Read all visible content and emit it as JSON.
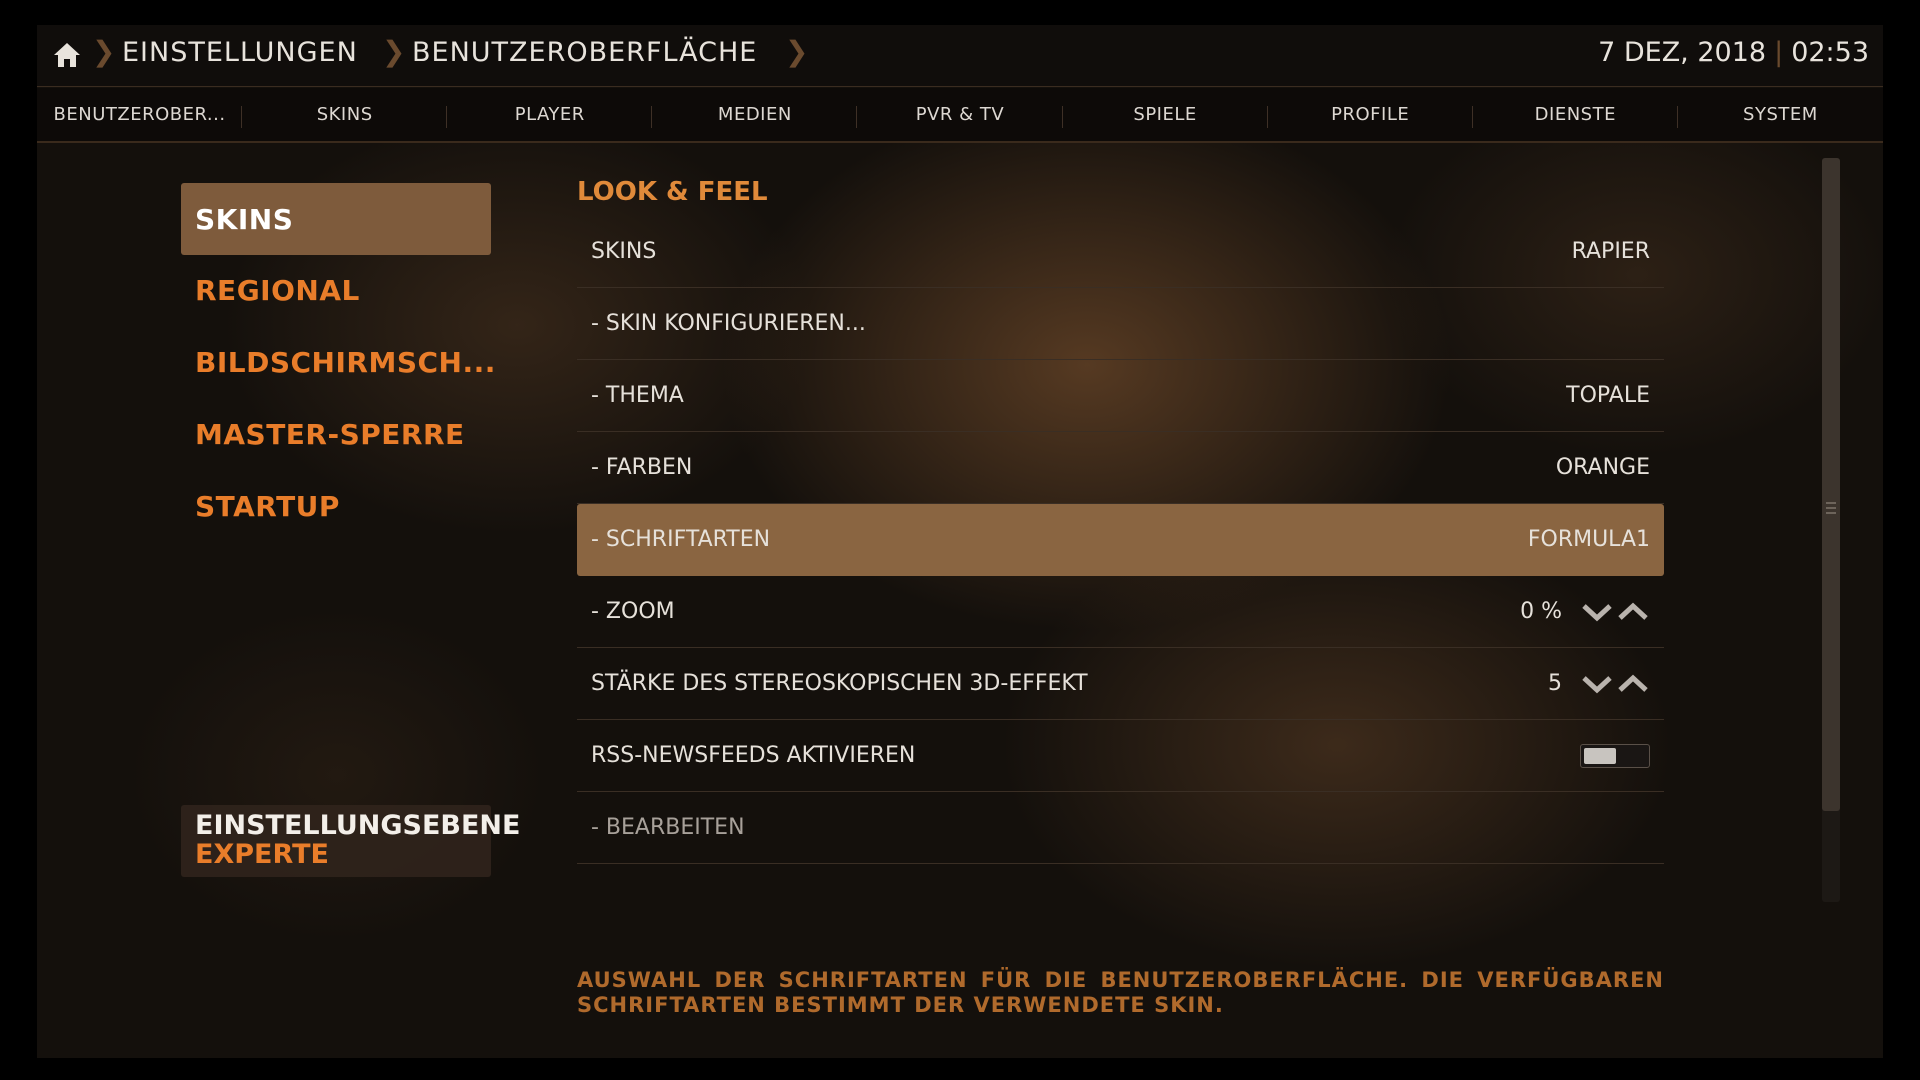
{
  "header": {
    "breadcrumbs": [
      "EINSTELLUNGEN",
      "BENUTZEROBERFLÄCHE"
    ],
    "date": "7 DEZ, 2018",
    "time": "02:53"
  },
  "tabs": [
    "BENUTZEROBER...",
    "SKINS",
    "PLAYER",
    "MEDIEN",
    "PVR & TV",
    "SPIELE",
    "PROFILE",
    "DIENSTE",
    "SYSTEM"
  ],
  "categories": [
    "SKINS",
    "REGIONAL",
    "BILDSCHIRMSCH...",
    "MASTER-SPERRE",
    "STARTUP"
  ],
  "settings_level": {
    "title": "EINSTELLUNGSEBENE",
    "value": "EXPERTE"
  },
  "section_title": "LOOK & FEEL",
  "rows": [
    {
      "label": "SKINS",
      "value": "RAPIER"
    },
    {
      "label": "- SKIN KONFIGURIEREN...",
      "value": ""
    },
    {
      "label": "- THEMA",
      "value": "TOPALE"
    },
    {
      "label": "- FARBEN",
      "value": "ORANGE"
    },
    {
      "label": "- SCHRIFTARTEN",
      "value": "FORMULA1"
    },
    {
      "label": "- ZOOM",
      "value": "0 %"
    },
    {
      "label": "STÄRKE DES STEREOSKOPISCHEN 3D-EFFEKT",
      "value": "5"
    },
    {
      "label": "RSS-NEWSFEEDS AKTIVIEREN",
      "value": ""
    },
    {
      "label": "- BEARBEITEN",
      "value": ""
    }
  ],
  "rss_enabled": false,
  "description": "AUSWAHL DER SCHRIFTARTEN FÜR DIE BENUTZEROBERFLÄCHE. DIE VERFÜGBAREN SCHRIFTARTEN BESTIMMT DER VERWENDETE SKIN.",
  "colors": {
    "accent": "#e97d2a",
    "focus": "#8a6541",
    "background": "#14100c"
  }
}
